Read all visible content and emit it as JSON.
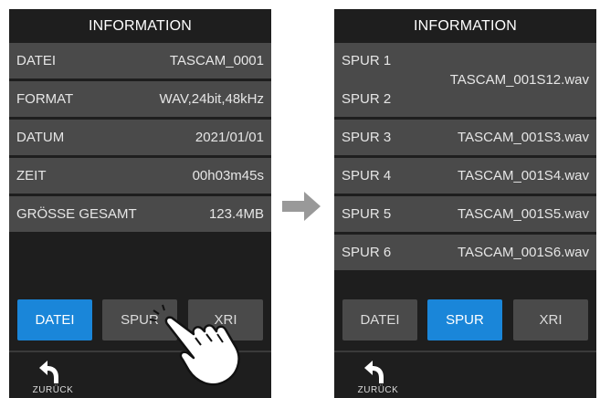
{
  "left_screen": {
    "title": "INFORMATION",
    "rows": [
      {
        "label": "DATEI",
        "value": "TASCAM_0001"
      },
      {
        "label": "FORMAT",
        "value": "WAV,24bit,48kHz"
      },
      {
        "label": "DATUM",
        "value": "2021/01/01"
      },
      {
        "label": "ZEIT",
        "value": "00h03m45s"
      },
      {
        "label": "GRÖSSE GESAMT",
        "value": "123.4MB"
      }
    ],
    "tabs": [
      "DATEI",
      "SPUR",
      "XRI"
    ],
    "active_tab": "DATEI",
    "back_label": "ZURÜCK"
  },
  "right_screen": {
    "title": "INFORMATION",
    "rows": [
      {
        "label": "SPUR 1",
        "label2": "SPUR 2",
        "value": "TASCAM_001S12.wav"
      },
      {
        "label": "SPUR 3",
        "value": "TASCAM_001S3.wav"
      },
      {
        "label": "SPUR 4",
        "value": "TASCAM_001S4.wav"
      },
      {
        "label": "SPUR 5",
        "value": "TASCAM_001S5.wav"
      },
      {
        "label": "SPUR 6",
        "value": "TASCAM_001S6.wav"
      }
    ],
    "tabs": [
      "DATEI",
      "SPUR",
      "XRI"
    ],
    "active_tab": "SPUR",
    "back_label": "ZURÜCK"
  },
  "icons": {
    "transition": "right-arrow-icon",
    "gesture": "tapping-hand-icon",
    "back": "back-arrow-icon"
  },
  "colors": {
    "screen_bg": "#1e1e1e",
    "row_bg": "#4a4a4a",
    "tab_bg": "#4a4a4a",
    "active_tab": "#1a86d9",
    "arrow": "#999999"
  }
}
